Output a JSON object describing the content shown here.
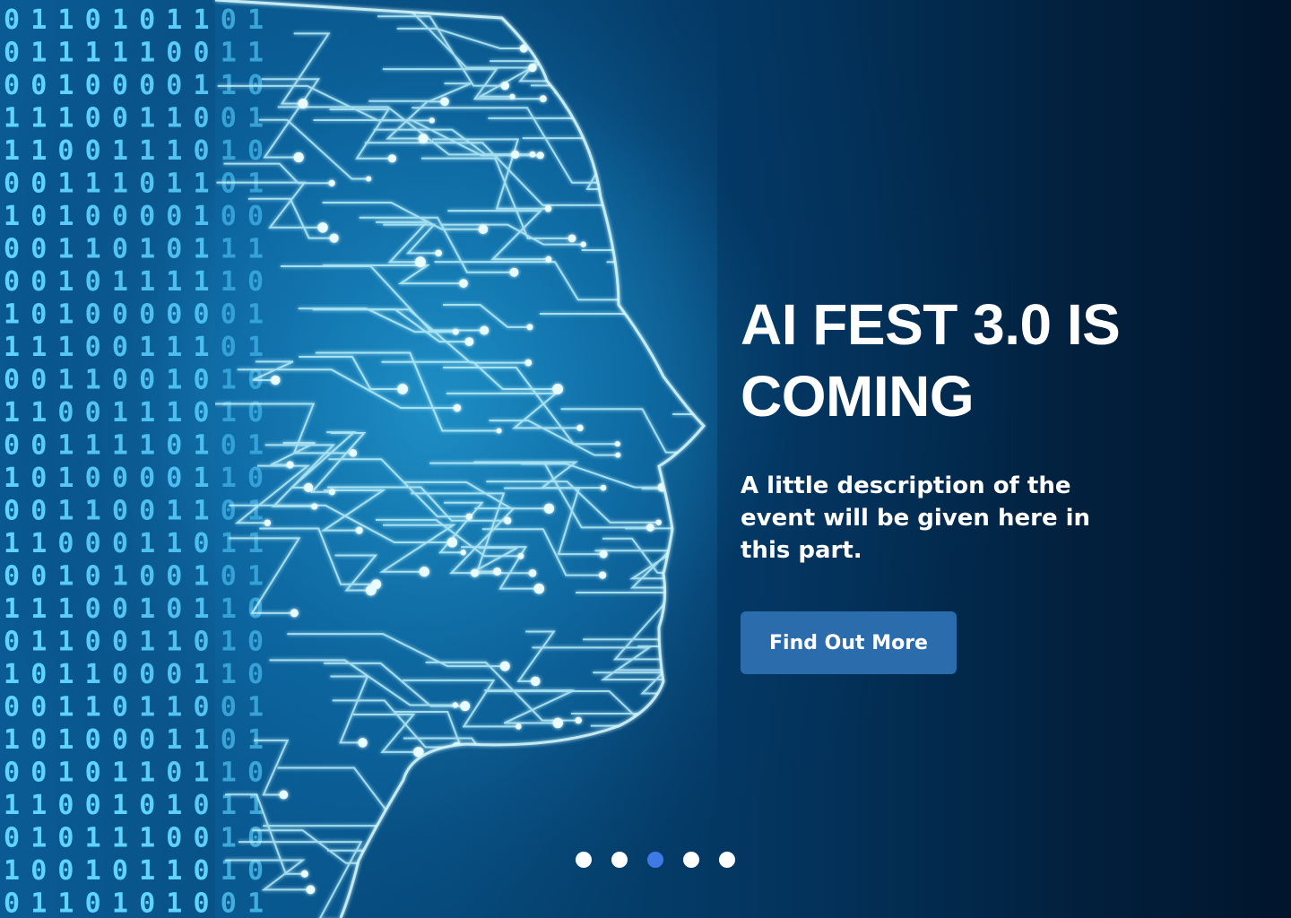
{
  "hero": {
    "title": "AI FEST 3.0 IS COMING",
    "description": "A little description of the event will be given here in this part.",
    "cta_label": "Find Out More",
    "cta_color": "#2b6cad"
  },
  "carousel": {
    "slide_count": 5,
    "active_index": 2,
    "active_color": "#3f79e6",
    "inactive_color": "#ffffff"
  },
  "background": {
    "image": "circuit-head-illustration",
    "binary_rows": [
      "0110101101",
      "0111110011",
      "0010000110",
      "1110011001",
      "1100111010",
      "0011101101",
      "1010000100",
      "0011010111",
      "0010111110",
      "1010000001",
      "1110011101",
      "0011001010",
      "1100111010",
      "0011110101",
      "1010000110",
      "0011001101",
      "1100011011",
      "0010100101",
      "1110010110",
      "0110011010",
      "1011000110",
      "0011011001",
      "1010001101",
      "0010110110",
      "1100101011",
      "0101110010",
      "1001011010",
      "0110101001"
    ]
  }
}
